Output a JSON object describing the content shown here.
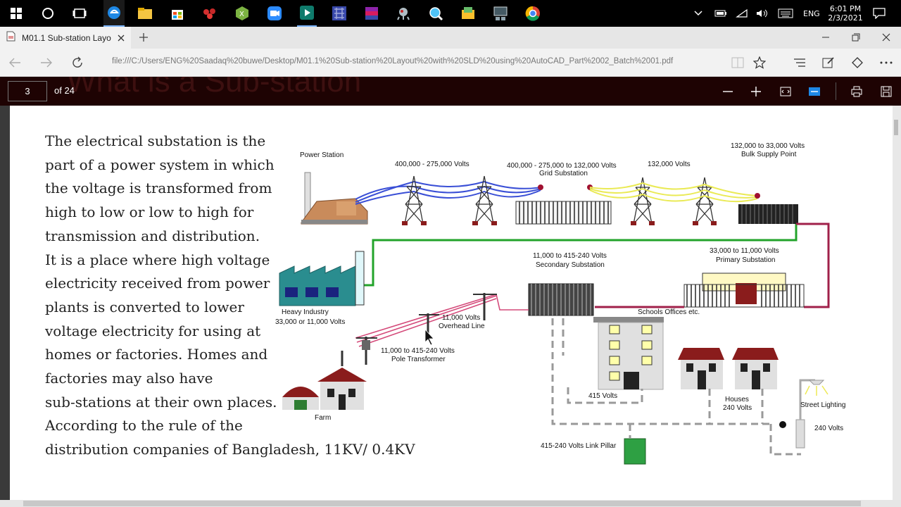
{
  "taskbar": {
    "tray": {
      "lang": "ENG",
      "time": "6:01 PM",
      "date": "2/3/2021"
    },
    "icons": [
      "windows-start-icon",
      "cortana-icon",
      "task-view-icon",
      "edge-icon",
      "file-explorer-icon",
      "store-icon",
      "app-red-icon",
      "excel-like-icon",
      "zoom-icon",
      "filmora-icon",
      "app-grid-icon",
      "winrar-icon",
      "bug-app-icon",
      "search-app-icon",
      "folder-app-icon",
      "network-app-icon",
      "chrome-icon"
    ]
  },
  "browser": {
    "tab_title": "M01.1 Sub-station Layo",
    "url": "file:///C:/Users/ENG%20Saadaq%20buwe/Desktop/M01.1%20Sub-station%20Layout%20with%20SLD%20using%20AutoCAD_Part%2002_Batch%2001.pdf"
  },
  "pdf_toolbar": {
    "page_number": "3",
    "page_total": "of 24",
    "ghost_title": "What is a Sub-station"
  },
  "slide": {
    "paragraph_lines": [
      "The electrical substation is the",
      "part of a power system in which",
      "the voltage is transformed from",
      "high to low or low to high for",
      "transmission and distribution.",
      "It is a place where high voltage",
      "electricity received from power",
      "plants is converted to lower",
      "voltage electricity for using at",
      "homes or factories. Homes and",
      "factories may also have",
      "sub-stations at their own places.",
      "According to the rule of the",
      "distribution companies of Bangladesh, 11KV/ 0.4KV"
    ],
    "diagram_labels": {
      "power_station": "Power Station",
      "v400_275": "400,000 - 275,000 Volts",
      "grid_sub_1": "400,000 - 275,000  to 132,000 Volts",
      "grid_sub_2": "Grid Substation",
      "v132": "132,000 Volts",
      "bulk_1": "132,000  to  33,000 Volts",
      "bulk_2": "Bulk Supply Point",
      "secondary_1": "11,000 to 415-240 Volts",
      "secondary_2": "Secondary Substation",
      "primary_1": "33,000  to 11,000 Volts",
      "primary_2": "Primary Substation",
      "heavy_1": "Heavy Industry",
      "heavy_2": "33,000 or 11,000 Volts",
      "overhead_1": "11,000  Volts",
      "overhead_2": "Overhead  Line",
      "pole_1": "11,000 to 415-240 Volts",
      "pole_2": "Pole Transformer",
      "schools": "Schools  Offices  etc.",
      "v415": "415 Volts",
      "houses_1": "Houses",
      "houses_2": "240 Volts",
      "street": "Street Lighting",
      "v240": "240 Volts",
      "farm": "Farm",
      "link_pillar": "415-240 Volts Link Pillar"
    }
  },
  "colors": {
    "accent_red": "#c0392b",
    "line_blue": "#3a4fd6",
    "line_yellow": "#f5f07a",
    "line_green": "#22a32a",
    "line_maroon": "#a0204a",
    "line_pink": "#d44a7a"
  }
}
